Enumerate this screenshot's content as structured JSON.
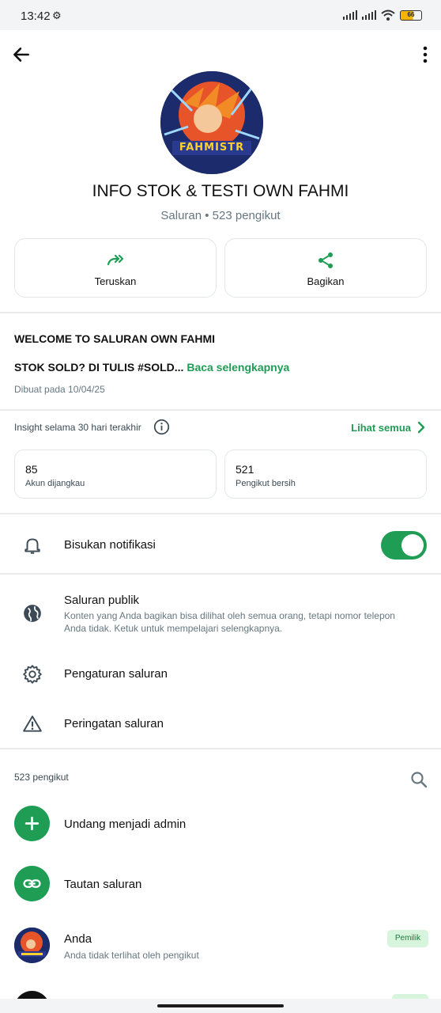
{
  "status_bar": {
    "time": "13:42",
    "battery": "66"
  },
  "channel": {
    "name": "INFO STOK & TESTI OWN FAHMI",
    "subtitle": "Saluran • 523 pengikut",
    "avatar_text": "FAHMISTR"
  },
  "actions": [
    {
      "label": "Teruskan",
      "icon": "forward-icon"
    },
    {
      "label": "Bagikan",
      "icon": "share-icon"
    }
  ],
  "description": {
    "title": "WELCOME TO SALURAN OWN FAHMI",
    "line": "STOK SOLD? DI TULIS #SOLD...",
    "more": "Baca selengkapnya",
    "created": "Dibuat pada 10/04/25"
  },
  "insights": {
    "label": "Insight selama 30 hari terakhir",
    "see_all": "Lihat semua",
    "stats": [
      {
        "value": "85",
        "caption": "Akun dijangkau"
      },
      {
        "value": "521",
        "caption": "Pengikut bersih"
      }
    ]
  },
  "settings": {
    "mute_label": "Bisukan notifikasi",
    "mute_on": true,
    "public_label": "Saluran publik",
    "public_desc": "Konten yang Anda bagikan bisa dilihat oleh semua orang, tetapi nomor telepon Anda tidak. Ketuk untuk mempelajari selengkapnya.",
    "channel_settings": "Pengaturan saluran",
    "channel_warning": "Peringatan saluran"
  },
  "followers": {
    "count_label": "523 pengikut",
    "invite_admin": "Undang menjadi admin",
    "channel_link": "Tautan saluran",
    "you_name": "Anda",
    "you_desc": "Anda tidak terlihat oleh pengikut",
    "owner_badge": "Pemilik"
  },
  "colors": {
    "accent": "#1f9d55",
    "badge_bg": "#d7f5dc"
  }
}
